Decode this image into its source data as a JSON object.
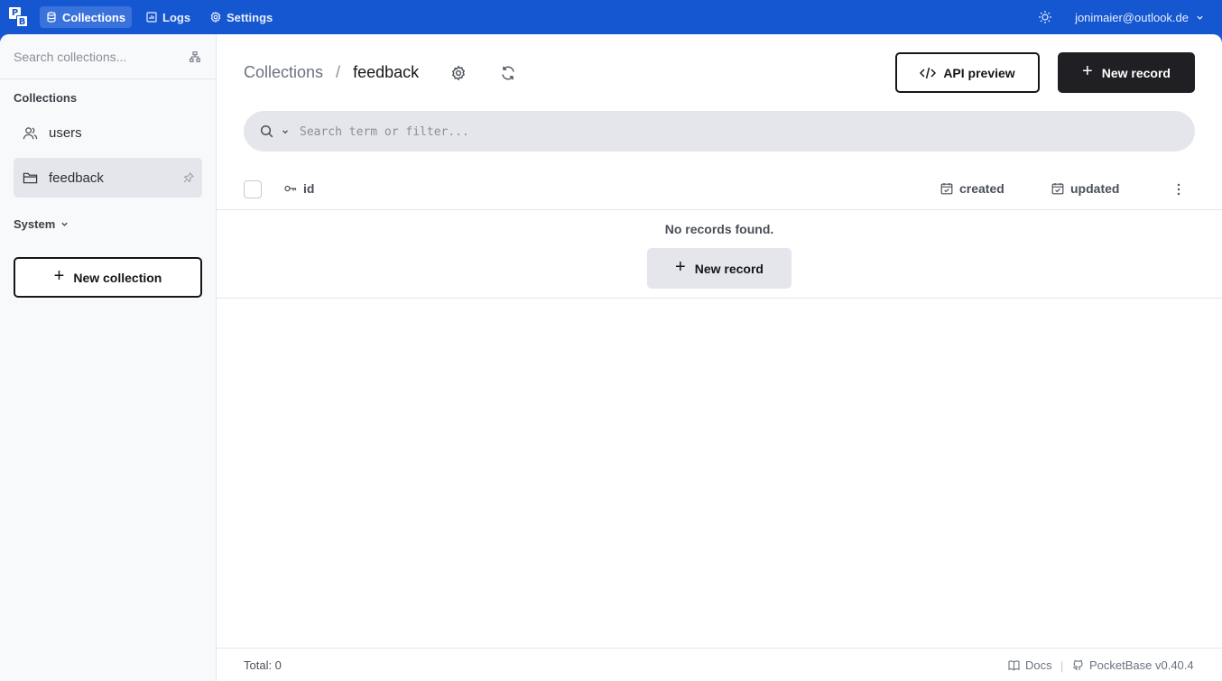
{
  "topbar": {
    "logo_letters": [
      "P",
      "B"
    ],
    "nav": [
      {
        "label": "Collections",
        "icon": "database-icon",
        "active": true
      },
      {
        "label": "Logs",
        "icon": "chart-icon",
        "active": false
      },
      {
        "label": "Settings",
        "icon": "gear-icon",
        "active": false
      }
    ],
    "user_email": "jonimaier@outlook.de",
    "accent": "#1557d0"
  },
  "sidebar": {
    "search_placeholder": "Search collections...",
    "collections_title": "Collections",
    "items": [
      {
        "label": "users",
        "icon": "users-icon",
        "active": false
      },
      {
        "label": "feedback",
        "icon": "folder-icon",
        "active": true
      }
    ],
    "system_label": "System",
    "new_collection_label": "New collection"
  },
  "main": {
    "breadcrumb": {
      "root": "Collections",
      "separator": "/",
      "current": "feedback"
    },
    "api_preview_label": "API preview",
    "new_record_label": "New record",
    "search_placeholder": "Search term or filter...",
    "columns": [
      {
        "label": "id",
        "icon": "key-icon"
      },
      {
        "label": "created",
        "icon": "calendar-icon"
      },
      {
        "label": "updated",
        "icon": "calendar-icon"
      }
    ],
    "empty_text": "No records found.",
    "empty_button_label": "New record"
  },
  "footer": {
    "total": "Total: 0",
    "docs_label": "Docs",
    "divider": "|",
    "version": "PocketBase v0.40.4"
  }
}
